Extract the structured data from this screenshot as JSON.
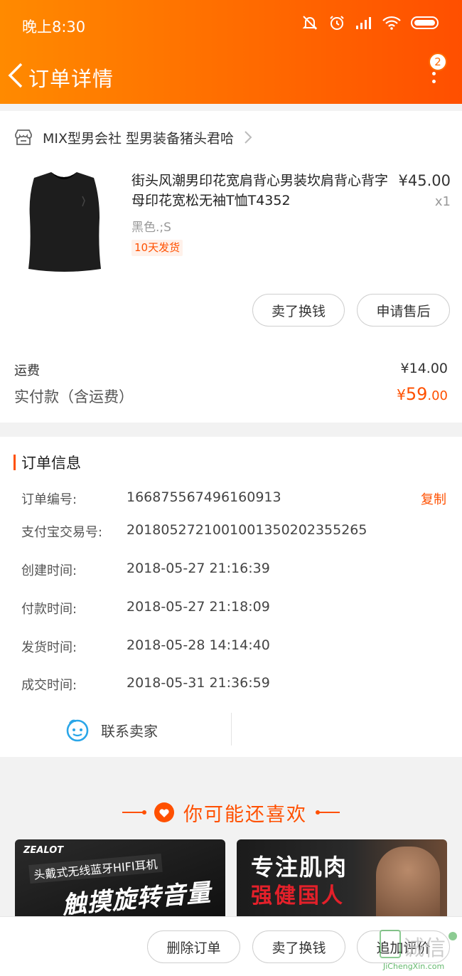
{
  "status_bar": {
    "time": "晚上8:30"
  },
  "nav": {
    "title": "订单详情",
    "badge_count": "2"
  },
  "shop": {
    "name": "MIX型男会社  型男装备猪头君哈"
  },
  "product": {
    "title": "街头风潮男印花宽肩背心男装坎肩背心背字母印花宽松无袖T恤T4352",
    "price": "¥45.00",
    "quantity": "x1",
    "sku": "黑色.;S",
    "shipping_tag": "10天发货"
  },
  "item_actions": {
    "sell_label": "卖了换钱",
    "after_sale_label": "申请售后"
  },
  "payment": {
    "fee_label": "运费",
    "fee_value": "¥14.00",
    "paid_label": "实付款（含运费）",
    "paid_currency": "¥",
    "paid_integer": "59",
    "paid_decimal": ".00"
  },
  "order_info": {
    "section_title": "订单信息",
    "copy_label": "复制",
    "rows": [
      {
        "label": "订单编号:",
        "value": "166875567496160913"
      },
      {
        "label": "支付宝交易号:",
        "value": "2018052721001001350202355265"
      },
      {
        "label": "创建时间:",
        "value": "2018-05-27 21:16:39"
      },
      {
        "label": "付款时间:",
        "value": "2018-05-27 21:18:09"
      },
      {
        "label": "发货时间:",
        "value": "2018-05-28 14:14:40"
      },
      {
        "label": "成交时间:",
        "value": "2018-05-31 21:36:59"
      }
    ],
    "contact_label": "联系卖家"
  },
  "recommend": {
    "title": "你可能还喜欢",
    "items": [
      {
        "brand": "ZEALOT",
        "line1": "头戴式无线蓝牙HIFI耳机",
        "line2": "触摸旋转音量"
      },
      {
        "line1": "专注肌肉",
        "line2": "强健国人"
      }
    ]
  },
  "bottom_actions": {
    "delete_label": "删除订单",
    "sell_label": "卖了换钱",
    "review_label": "追加评价"
  },
  "watermark": {
    "text": "诚信",
    "sub": "JiChengXin.com"
  },
  "colors": {
    "accent": "#ff5000",
    "header_start": "#ff8a00",
    "header_end": "#ff4f00"
  }
}
